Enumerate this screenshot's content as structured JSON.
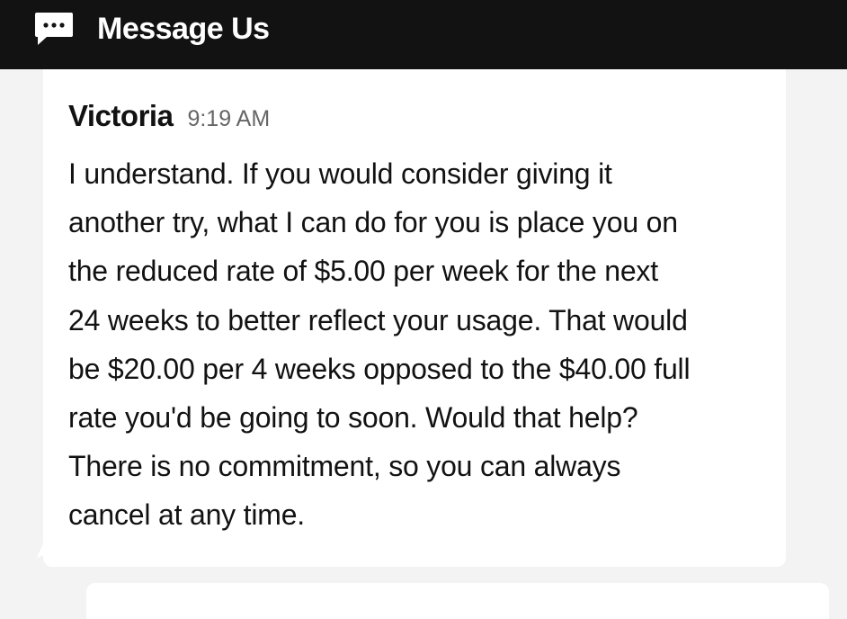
{
  "header": {
    "title": "Message Us",
    "icon": "chat-bubble-icon"
  },
  "message": {
    "sender": "Victoria",
    "time": "9:19 AM",
    "lines": [
      "I understand. If you would consider giving it",
      "another try, what I can do for you is place you on",
      "the reduced rate of $5.00 per week for the next",
      "24 weeks to better reflect your usage. That would",
      "be $20.00 per 4 weeks opposed to the $40.00 full",
      "rate you'd be going to soon. Would that help?",
      "There is no commitment, so you can always",
      "cancel at any time."
    ]
  },
  "colors": {
    "header_bg": "#121212",
    "page_bg": "#f3f3f3",
    "card_bg": "#ffffff",
    "text": "#121212",
    "timestamp": "#666666"
  }
}
